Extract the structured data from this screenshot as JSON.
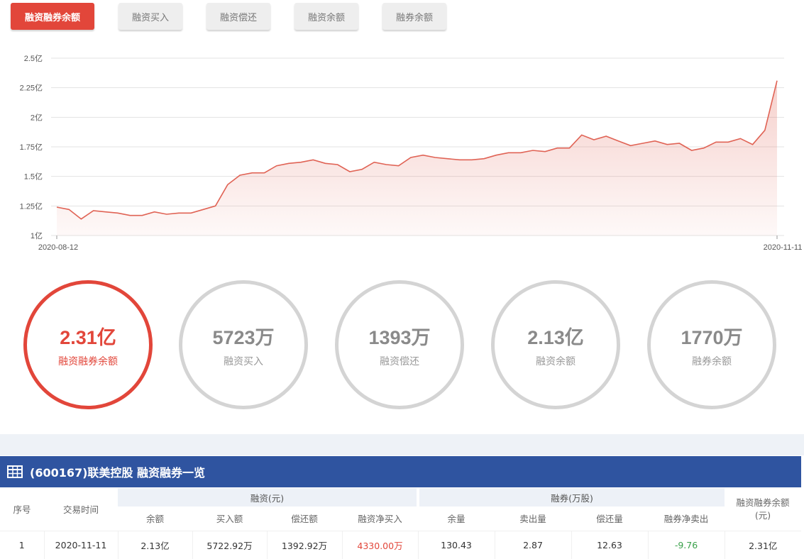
{
  "tabs": [
    "融资融券余额",
    "融资买入",
    "融资偿还",
    "融资余额",
    "融券余额"
  ],
  "chart_data": {
    "type": "area",
    "series": [
      {
        "values": [
          1.24,
          1.22,
          1.14,
          1.21,
          1.2,
          1.19,
          1.17,
          1.17,
          1.2,
          1.18,
          1.19,
          1.19,
          1.22,
          1.25,
          1.43,
          1.51,
          1.53,
          1.53,
          1.59,
          1.61,
          1.62,
          1.64,
          1.61,
          1.6,
          1.54,
          1.56,
          1.62,
          1.6,
          1.59,
          1.66,
          1.68,
          1.66,
          1.65,
          1.64,
          1.64,
          1.65,
          1.68,
          1.7,
          1.7,
          1.72,
          1.71,
          1.74,
          1.74,
          1.85,
          1.81,
          1.84,
          1.8,
          1.76,
          1.78,
          1.8,
          1.77,
          1.78,
          1.72,
          1.74,
          1.79,
          1.79,
          1.82,
          1.77,
          1.89,
          2.31
        ]
      }
    ],
    "x_start": "2020-08-12",
    "x_end": "2020-11-11",
    "y_ticks": [
      "2.5亿",
      "2.25亿",
      "2亿",
      "1.75亿",
      "1.5亿",
      "1.25亿",
      "1亿"
    ],
    "ylim": [
      1,
      2.5
    ],
    "line_color": "#e06355",
    "grid": true
  },
  "circles": [
    {
      "value": "2.31亿",
      "label": "融资融券余额"
    },
    {
      "value": "5723万",
      "label": "融资买入"
    },
    {
      "value": "1393万",
      "label": "融资偿还"
    },
    {
      "value": "2.13亿",
      "label": "融资余额"
    },
    {
      "value": "1770万",
      "label": "融券余额"
    }
  ],
  "table": {
    "title": "(600167)联美控股 融资融券一览",
    "group_financing": "融资(元)",
    "group_securities": "融券(万股)",
    "col_index": "序号",
    "col_date": "交易时间",
    "col_total": "融资融券余额\n(元)",
    "sub_headers": [
      "余额",
      "买入额",
      "偿还额",
      "融资净买入",
      "余量",
      "卖出量",
      "偿还量",
      "融券净卖出"
    ],
    "rows": [
      {
        "cells": [
          "1",
          "2020-11-11",
          "2.13亿",
          "5722.92万",
          "1392.92万",
          "4330.00万",
          "130.43",
          "2.87",
          "12.63",
          "-9.76",
          "2.31亿"
        ]
      }
    ]
  },
  "colors": {
    "accent": "#e2463a",
    "header": "#2f54a0",
    "negative": "#3aa14a"
  },
  "icons": {
    "table_icon": "table-grid-icon"
  }
}
